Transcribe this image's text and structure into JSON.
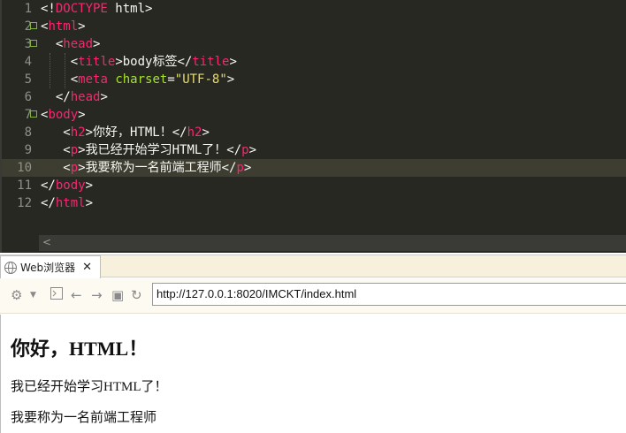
{
  "editor": {
    "lines": [
      {
        "num": "1",
        "parts": [
          [
            "p",
            "<!"
          ],
          [
            "t",
            "DOCTYPE"
          ],
          [
            "p",
            " html>"
          ]
        ]
      },
      {
        "num": "2",
        "fold": true,
        "parts": [
          [
            "p",
            "<"
          ],
          [
            "t",
            "html"
          ],
          [
            "p",
            ">"
          ]
        ]
      },
      {
        "num": "3",
        "fold": true,
        "parts": [
          [
            "p",
            "  <"
          ],
          [
            "t",
            "head"
          ],
          [
            "p",
            ">"
          ]
        ]
      },
      {
        "num": "4",
        "parts": [
          [
            "p",
            "    <"
          ],
          [
            "t",
            "title"
          ],
          [
            "p",
            ">body标签</"
          ],
          [
            "t",
            "title"
          ],
          [
            "p",
            ">"
          ]
        ]
      },
      {
        "num": "5",
        "parts": [
          [
            "p",
            "    <"
          ],
          [
            "t",
            "meta"
          ],
          [
            "p",
            " "
          ],
          [
            "a",
            "charset"
          ],
          [
            "p",
            "="
          ],
          [
            "s",
            "\"UTF-8\""
          ],
          [
            "p",
            ">"
          ]
        ]
      },
      {
        "num": "6",
        "parts": [
          [
            "p",
            "  </"
          ],
          [
            "t",
            "head"
          ],
          [
            "p",
            ">"
          ]
        ]
      },
      {
        "num": "7",
        "fold": true,
        "parts": [
          [
            "p",
            "<"
          ],
          [
            "t",
            "body"
          ],
          [
            "p",
            ">"
          ]
        ]
      },
      {
        "num": "8",
        "parts": [
          [
            "p",
            "   <"
          ],
          [
            "t",
            "h2"
          ],
          [
            "p",
            ">你好，HTML！</"
          ],
          [
            "t",
            "h2"
          ],
          [
            "p",
            ">"
          ]
        ]
      },
      {
        "num": "9",
        "parts": [
          [
            "p",
            "   <"
          ],
          [
            "t",
            "p"
          ],
          [
            "p",
            ">我已经开始学习HTML了！</"
          ],
          [
            "t",
            "p"
          ],
          [
            "p",
            ">"
          ]
        ]
      },
      {
        "num": "10",
        "active": true,
        "parts": [
          [
            "p",
            "   <"
          ],
          [
            "t",
            "p"
          ],
          [
            "p",
            ">我要称为一名前端工程师</"
          ],
          [
            "t",
            "p"
          ],
          [
            "p",
            ">"
          ]
        ]
      },
      {
        "num": "11",
        "parts": [
          [
            "p",
            "</"
          ],
          [
            "t",
            "body"
          ],
          [
            "p",
            ">"
          ]
        ]
      },
      {
        "num": "12",
        "parts": [
          [
            "p",
            "</"
          ],
          [
            "t",
            "html"
          ],
          [
            "p",
            ">"
          ]
        ]
      }
    ],
    "scroll_left_arrow": "<"
  },
  "browser": {
    "tab_label": "Web浏览器",
    "tab_close": "✕",
    "url": "http://127.0.0.1:8020/IMCKT/index.html",
    "icons": [
      "gear-icon",
      "dropdown-icon",
      "terminal-icon",
      "back-icon",
      "forward-icon",
      "stop-icon",
      "reload-icon"
    ],
    "page": {
      "h2": "你好，HTML！",
      "p1": "我已经开始学习HTML了！",
      "p2": "我要称为一名前端工程师"
    }
  },
  "colors": {
    "editor_bg": "#272822",
    "tag": "#f92672",
    "attr": "#a6e22e",
    "string": "#e6db74",
    "text": "#f8f8f2"
  }
}
